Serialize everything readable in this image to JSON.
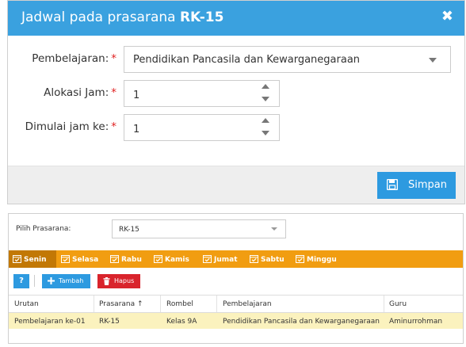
{
  "modal": {
    "title_prefix": "Jadwal pada prasarana",
    "title_bold": "RK-15",
    "close_symbol": "✖",
    "fields": [
      {
        "label": "Pembelajaran:",
        "required_mark": "*",
        "value": "Pendidikan Pancasila dan Kewarganegaraan"
      },
      {
        "label": "Alokasi Jam:",
        "required_mark": "*",
        "value": "1"
      },
      {
        "label": "Dimulai jam ke:",
        "required_mark": "*",
        "value": "1"
      }
    ],
    "save_label": "Simpan"
  },
  "panel": {
    "prasarana_label": "Pilih Prasarana:",
    "prasarana_value": "RK-15",
    "days": [
      "Senin",
      "Selasa",
      "Rabu",
      "Kamis",
      "Jumat",
      "Sabtu",
      "Minggu"
    ],
    "active_day": "Senin",
    "help_label": "?",
    "add_label": "Tambah",
    "delete_label": "Hapus",
    "columns": [
      "Urutan",
      "Prasarana",
      "Rombel",
      "Pembelajaran",
      "Guru"
    ],
    "sort_indicator": "↑",
    "rows": [
      [
        "Pembelajaran ke-01",
        "RK-15",
        "Kelas 9A",
        "Pendidikan Pancasila dan Kewarganegaraan",
        "Aminurrohman"
      ]
    ]
  },
  "colors": {
    "header_blue": "#3aa1df",
    "button_blue": "#2d9ae0",
    "day_bar_orange": "#f19d11",
    "active_day_orange": "#c27805",
    "delete_red": "#d9242c",
    "selected_row": "#fbf2be",
    "required_red": "#e02222"
  },
  "icons": [
    "close-icon",
    "chevron-down-icon",
    "spinner-up-icon",
    "spinner-down-icon",
    "save-disk-icon",
    "calendar-check-icon",
    "help-icon",
    "plus-icon",
    "trash-icon",
    "sort-asc-icon"
  ]
}
